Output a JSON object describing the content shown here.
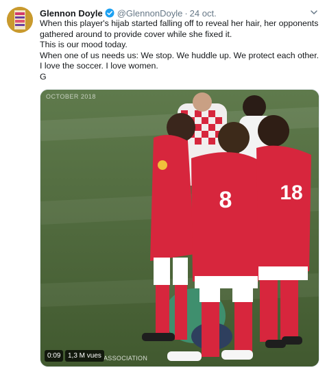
{
  "author": {
    "name": "Glennon Doyle",
    "handle": "@GlennonDoyle",
    "separator": "·",
    "date": "24 oct.",
    "verified_icon": "verified-badge-icon",
    "avatar_icon": "book-cover-avatar"
  },
  "tweet_lines": [
    "When this player's hijab started falling off to reveal her hair, her opponents gathered around to provide cover while she fixed it.",
    "This is our mood today.",
    "When one of us needs us: We stop. We huddle up. We protect each other.",
    "I love the soccer. I love women.",
    "G"
  ],
  "media": {
    "overlay_date": "OCTOBER 2018",
    "overlay_text": "ASSOCIATION",
    "player_numbers": [
      "8",
      "18"
    ],
    "timestamp": "0:09",
    "views": "1,3 M vues"
  },
  "colors": {
    "accent": "#1da1f2",
    "muted": "#657786",
    "jersey_red": "#d7263d",
    "pitch_green": "#4f6b3f"
  }
}
